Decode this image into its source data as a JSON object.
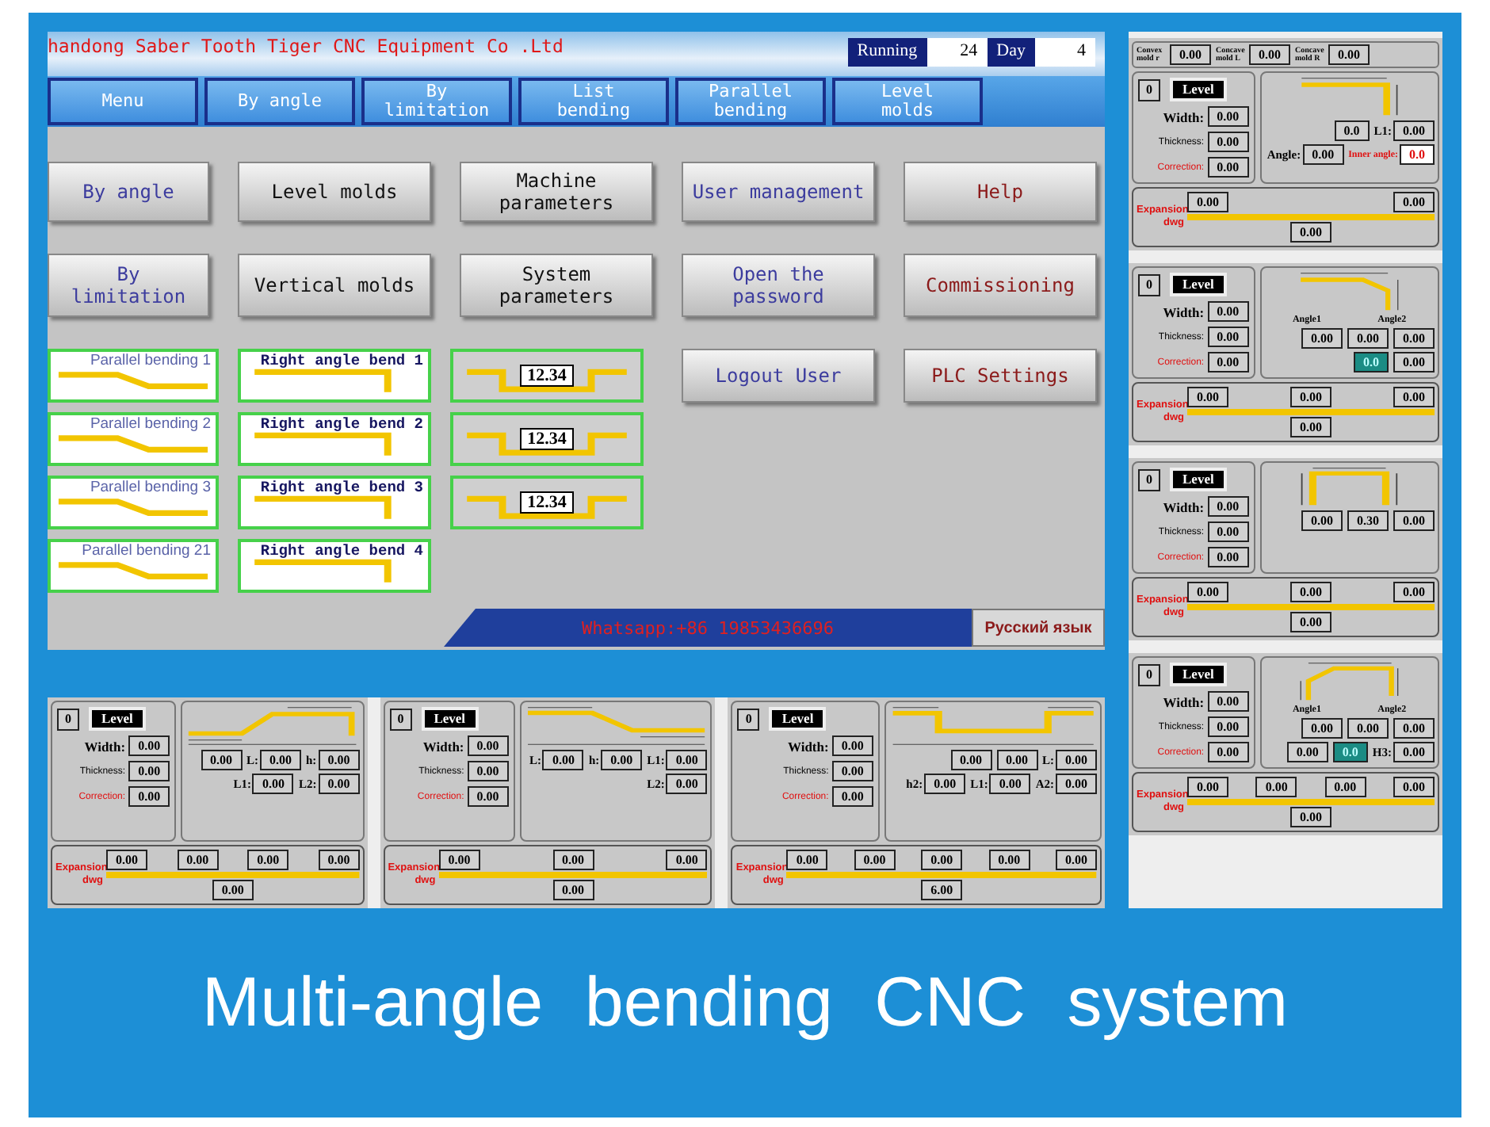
{
  "screen": {
    "title": "handong Saber Tooth Tiger CNC Equipment Co .Ltd",
    "status": [
      {
        "text": "Running",
        "kind": "label"
      },
      {
        "text": "24",
        "kind": "value"
      },
      {
        "text": "Day",
        "kind": "label"
      },
      {
        "text": "4",
        "kind": "value"
      }
    ],
    "tabs": [
      {
        "label": "Menu"
      },
      {
        "label": "By angle"
      },
      {
        "label": "By limitation"
      },
      {
        "label": "List bending"
      },
      {
        "label": "Parallel bending"
      },
      {
        "label": "Level molds"
      }
    ],
    "buttons": [
      {
        "label": "By angle",
        "color": "#3c3c9e"
      },
      {
        "label": "Level molds",
        "color": "#111111"
      },
      {
        "label": "Machine parameters",
        "color": "#111111"
      },
      {
        "label": "User management",
        "color": "#3c3c9e"
      },
      {
        "label": "Help",
        "color": "#8b1a1a"
      },
      {
        "label": "By limitation",
        "color": "#3c3c9e"
      },
      {
        "label": "Vertical molds",
        "color": "#111111"
      },
      {
        "label": "System parameters",
        "color": "#111111"
      },
      {
        "label": "Open the password",
        "color": "#3c3c9e"
      },
      {
        "label": "Commissioning",
        "color": "#8b1a1a"
      }
    ],
    "side_buttons": [
      {
        "label": "Logout User",
        "color": "#3c3c9e"
      },
      {
        "label": "PLC Settings",
        "color": "#8b1a1a"
      }
    ],
    "thumbnail_columns": [
      [
        {
          "kind": "parallel",
          "label": "Parallel bending 1"
        },
        {
          "kind": "parallel",
          "label": "Parallel bending 2"
        },
        {
          "kind": "parallel",
          "label": "Parallel bending 3"
        },
        {
          "kind": "parallel",
          "label": "Parallel bending 21"
        }
      ],
      [
        {
          "kind": "right",
          "label": "Right angle bend 1"
        },
        {
          "kind": "right",
          "label": "Right angle bend 2"
        },
        {
          "kind": "right",
          "label": "Right angle bend 3"
        },
        {
          "kind": "right",
          "label": "Right angle bend 4"
        }
      ],
      [
        {
          "kind": "mold",
          "label": "12.34"
        },
        {
          "kind": "mold",
          "label": "12.34"
        },
        {
          "kind": "mold",
          "label": "12.34"
        }
      ]
    ],
    "footer": {
      "contact": "Whatsapp:+86 19853436696",
      "language": "Русский язык"
    }
  },
  "side_panels": [
    {
      "kind": "corner",
      "top_fields": [
        {
          "label": "Convex mold r",
          "value": "0.00"
        },
        {
          "label": "Concave mold L",
          "value": "0.00"
        },
        {
          "label": "Concave mold R",
          "value": "0.00"
        }
      ],
      "number": "0",
      "mode": "Level",
      "fields": [
        {
          "label": "Width:",
          "value": "0.00",
          "kind": "bold"
        },
        {
          "label": "Thickness:",
          "value": "0.00",
          "kind": "small"
        },
        {
          "label": "Correction:",
          "value": "0.00",
          "kind": "red"
        }
      ],
      "diagram_fields": [
        {
          "value": "0.0"
        },
        {
          "label": "L1:",
          "value": "0.00"
        },
        {
          "label": "Angle:",
          "value": "0.00"
        },
        {
          "label": "Inner angle:",
          "value": "0.0",
          "kind": "red"
        }
      ],
      "expansion": {
        "label": "Expansion dwg",
        "segments": [
          "0.00",
          "0.00"
        ],
        "total": "0.00"
      }
    },
    {
      "kind": "bend2",
      "number": "0",
      "mode": "Level",
      "fields": [
        {
          "label": "Width:",
          "value": "0.00",
          "kind": "bold"
        },
        {
          "label": "Thickness:",
          "value": "0.00",
          "kind": "small"
        },
        {
          "label": "Correction:",
          "value": "0.00",
          "kind": "red"
        }
      ],
      "notes": [
        "Angle1",
        "Angle2"
      ],
      "diagram_fields": [
        {
          "value": "0.00"
        },
        {
          "value": "0.00"
        },
        {
          "value": "0.00"
        },
        {
          "value": "0.0",
          "kind": "teal"
        },
        {
          "value": "0.00"
        }
      ],
      "expansion": {
        "label": "Expansion dwg",
        "segments": [
          "0.00",
          "0.00",
          "0.00"
        ],
        "total": "0.00"
      }
    },
    {
      "kind": "channel",
      "number": "0",
      "mode": "Level",
      "fields": [
        {
          "label": "Width:",
          "value": "0.00",
          "kind": "bold"
        },
        {
          "label": "Thickness:",
          "value": "0.00",
          "kind": "small"
        },
        {
          "label": "Correction:",
          "value": "0.00",
          "kind": "red"
        }
      ],
      "diagram_fields": [
        {
          "value": "0.00"
        },
        {
          "value": "0.30"
        },
        {
          "value": "0.00"
        }
      ],
      "expansion": {
        "label": "Expansion dwg",
        "segments": [
          "0.00",
          "0.00",
          "0.00"
        ],
        "total": "0.00"
      }
    },
    {
      "kind": "bend2r",
      "number": "0",
      "mode": "Level",
      "fields": [
        {
          "label": "Width:",
          "value": "0.00",
          "kind": "bold"
        },
        {
          "label": "Thickness:",
          "value": "0.00",
          "kind": "small"
        },
        {
          "label": "Correction:",
          "value": "0.00",
          "kind": "red"
        }
      ],
      "notes": [
        "Angle1",
        "Angle2"
      ],
      "diagram_fields": [
        {
          "value": "0.00"
        },
        {
          "value": "0.00"
        },
        {
          "value": "0.00"
        },
        {
          "value": "0.00"
        },
        {
          "value": "0.0",
          "kind": "teal"
        },
        {
          "label": "H3:",
          "value": "0.00"
        }
      ],
      "expansion": {
        "label": "Expansion dwg",
        "segments": [
          "0.00",
          "0.00",
          "0.00",
          "0.00"
        ],
        "total": "0.00"
      }
    }
  ],
  "bottom_panels": [
    {
      "kind": "zup",
      "number": "0",
      "mode": "Level",
      "fields": [
        {
          "label": "Width:",
          "value": "0.00",
          "kind": "bold"
        },
        {
          "label": "Thickness:",
          "value": "0.00",
          "kind": "small"
        },
        {
          "label": "Correction:",
          "value": "0.00",
          "kind": "red"
        }
      ],
      "diagram_fields": [
        {
          "value": "0.00"
        },
        {
          "label": "L:",
          "value": "0.00"
        },
        {
          "label": "h:",
          "value": "0.00"
        },
        {
          "label": "L1:",
          "value": "0.00"
        },
        {
          "label": "L2:",
          "value": "0.00"
        }
      ],
      "expansion": {
        "label": "Expansion dwg",
        "segments": [
          "0.00",
          "0.00",
          "0.00",
          "0.00"
        ],
        "total": "0.00"
      }
    },
    {
      "kind": "zdown",
      "number": "0",
      "mode": "Level",
      "fields": [
        {
          "label": "Width:",
          "value": "0.00",
          "kind": "bold"
        },
        {
          "label": "Thickness:",
          "value": "0.00",
          "kind": "small"
        },
        {
          "label": "Correction:",
          "value": "0.00",
          "kind": "red"
        }
      ],
      "diagram_fields": [
        {
          "label": "L:",
          "value": "0.00"
        },
        {
          "label": "h:",
          "value": "0.00"
        },
        {
          "label": "L1:",
          "value": "0.00"
        },
        {
          "label": "L2:",
          "value": "0.00"
        }
      ],
      "expansion": {
        "label": "Expansion dwg",
        "segments": [
          "0.00",
          "0.00",
          "0.00"
        ],
        "total": "0.00"
      }
    },
    {
      "kind": "hat",
      "number": "0",
      "mode": "Level",
      "fields": [
        {
          "label": "Width:",
          "value": "0.00",
          "kind": "bold"
        },
        {
          "label": "Thickness:",
          "value": "0.00",
          "kind": "small"
        },
        {
          "label": "Correction:",
          "value": "0.00",
          "kind": "red"
        }
      ],
      "diagram_fields": [
        {
          "value": "0.00"
        },
        {
          "value": "0.00"
        },
        {
          "label": "L:",
          "value": "0.00"
        },
        {
          "label": "h2:",
          "value": "0.00"
        },
        {
          "label": "L1:",
          "value": "0.00"
        },
        {
          "label": "A2:",
          "value": "0.00"
        }
      ],
      "expansion": {
        "label": "Expansion dwg",
        "segments": [
          "0.00",
          "0.00",
          "0.00",
          "0.00",
          "0.00"
        ],
        "total": "6.00"
      }
    }
  ],
  "caption": "Multi-angle bending CNC system"
}
